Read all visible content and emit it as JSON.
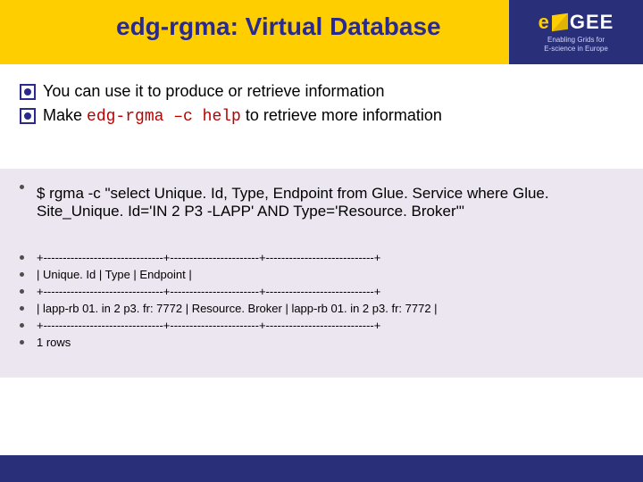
{
  "title": "edg-rgma: Virtual Database",
  "logo": {
    "text": "GEE",
    "sub_line1": "Enabling Grids for",
    "sub_line2": "E-science in Europe"
  },
  "bullets": {
    "b1_text": "You can use it to produce or retrieve information",
    "b2_lead": "Make ",
    "b2_code": "edg-rgma –c help",
    "b2_tail": " to retrieve more information"
  },
  "command": {
    "line": "$ rgma -c \"select Unique. Id, Type, Endpoint  from Glue. Service where Glue. Site_Unique. Id='IN 2 P3 -LAPP' AND Type='Resource. Broker'\""
  },
  "table": {
    "sep_top": "+-------------------------------+-----------------------+----------------------------+",
    "headers": "| Unique. Id                       | Type                    | Endpoint                       |",
    "sep_mid": "+-------------------------------+-----------------------+----------------------------+",
    "row1": "| lapp-rb 01. in 2 p3. fr: 7772 | Resource. Broker    | lapp-rb 01. in 2 p3. fr: 7772 |",
    "sep_bot": "+-------------------------------+-----------------------+----------------------------+",
    "rowcount": "1 rows"
  }
}
